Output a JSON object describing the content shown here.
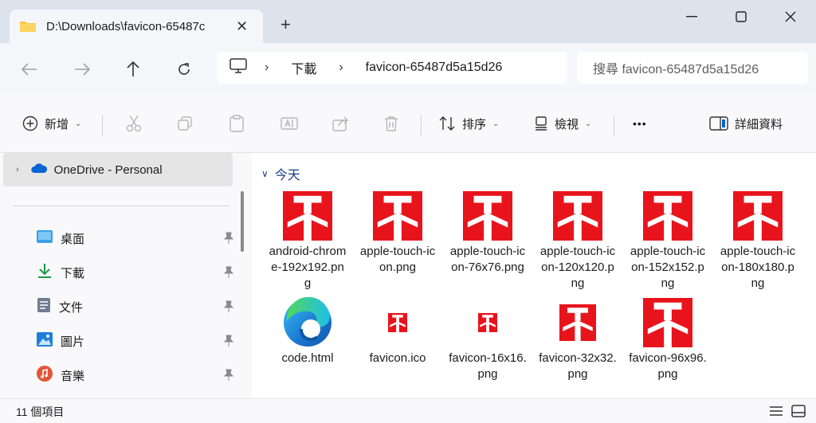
{
  "tab": {
    "title": "D:\\Downloads\\favicon-65487c",
    "close": "✕",
    "new_tab": "+"
  },
  "window": {
    "minimize": "—",
    "maximize": "☐",
    "close": "✕"
  },
  "address": {
    "crumbs": [
      "下載",
      "favicon-65487d5a15d26"
    ],
    "separator": "›"
  },
  "search": {
    "placeholder": "搜尋 favicon-65487d5a15d26"
  },
  "toolbar": {
    "new_label": "新增",
    "sort_label": "排序",
    "view_label": "檢視",
    "more_label": "•••",
    "details_label": "詳細資料"
  },
  "sidebar": {
    "onedrive": "OneDrive - Personal",
    "items": [
      {
        "label": "桌面",
        "icon": "desktop-icon"
      },
      {
        "label": "下載",
        "icon": "download-icon"
      },
      {
        "label": "文件",
        "icon": "document-icon"
      },
      {
        "label": "圖片",
        "icon": "picture-icon"
      },
      {
        "label": "音樂",
        "icon": "music-icon"
      }
    ]
  },
  "content": {
    "group": "今天",
    "files": [
      {
        "name": "android-chrome-192x192.png",
        "kind": "favicon",
        "size": "l"
      },
      {
        "name": "apple-touch-icon.png",
        "kind": "favicon",
        "size": "l"
      },
      {
        "name": "apple-touch-icon-76x76.png",
        "kind": "favicon",
        "size": "l"
      },
      {
        "name": "apple-touch-icon-120x120.png",
        "kind": "favicon",
        "size": "l"
      },
      {
        "name": "apple-touch-icon-152x152.png",
        "kind": "favicon",
        "size": "l"
      },
      {
        "name": "apple-touch-icon-180x180.png",
        "kind": "favicon",
        "size": "l"
      },
      {
        "name": "code.html",
        "kind": "edge",
        "size": "l"
      },
      {
        "name": "favicon.ico",
        "kind": "favicon",
        "size": "xs"
      },
      {
        "name": "favicon-16x16.png",
        "kind": "favicon",
        "size": "xs"
      },
      {
        "name": "favicon-32x32.png",
        "kind": "favicon",
        "size": "m"
      },
      {
        "name": "favicon-96x96.png",
        "kind": "favicon",
        "size": "l"
      }
    ]
  },
  "status": {
    "count": "11 個項目"
  },
  "colors": {
    "favicon_red": "#e8141c",
    "accent": "#0067c0",
    "folder": "#f7c948"
  }
}
